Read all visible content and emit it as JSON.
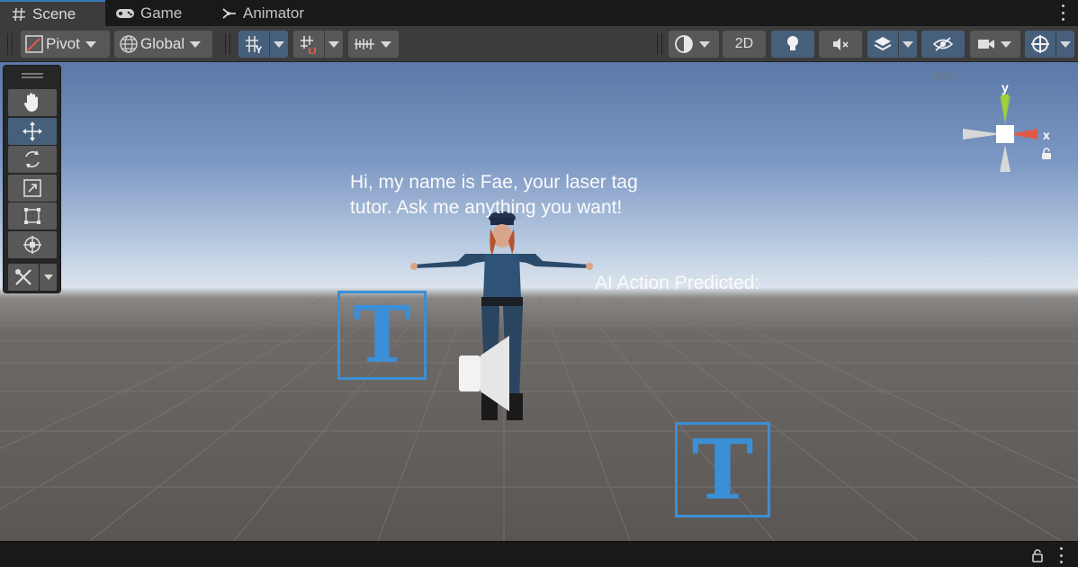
{
  "tabs": [
    {
      "label": "Scene",
      "icon": "hash-icon",
      "active": true
    },
    {
      "label": "Game",
      "icon": "gamepad-icon",
      "active": false
    },
    {
      "label": "Animator",
      "icon": "animator-icon",
      "active": false
    }
  ],
  "toolbar": {
    "pivot_label": "Pivot",
    "global_label": "Global",
    "twod_label": "2D"
  },
  "scene": {
    "speech_text": "Hi, my name is Fae, your laser tag tutor. Ask me anything you want!",
    "ai_action_label": "AI Action Predicted:",
    "persp_label": "Persp",
    "gizmo_y": "y",
    "gizmo_x": "x",
    "text_icon_glyph": "T"
  },
  "colors": {
    "accent": "#3a79bb",
    "text_icon": "#3a8fd6",
    "active_button": "#46607c",
    "gizmo_y": "#9fd33c",
    "gizmo_x": "#e05a4a"
  }
}
